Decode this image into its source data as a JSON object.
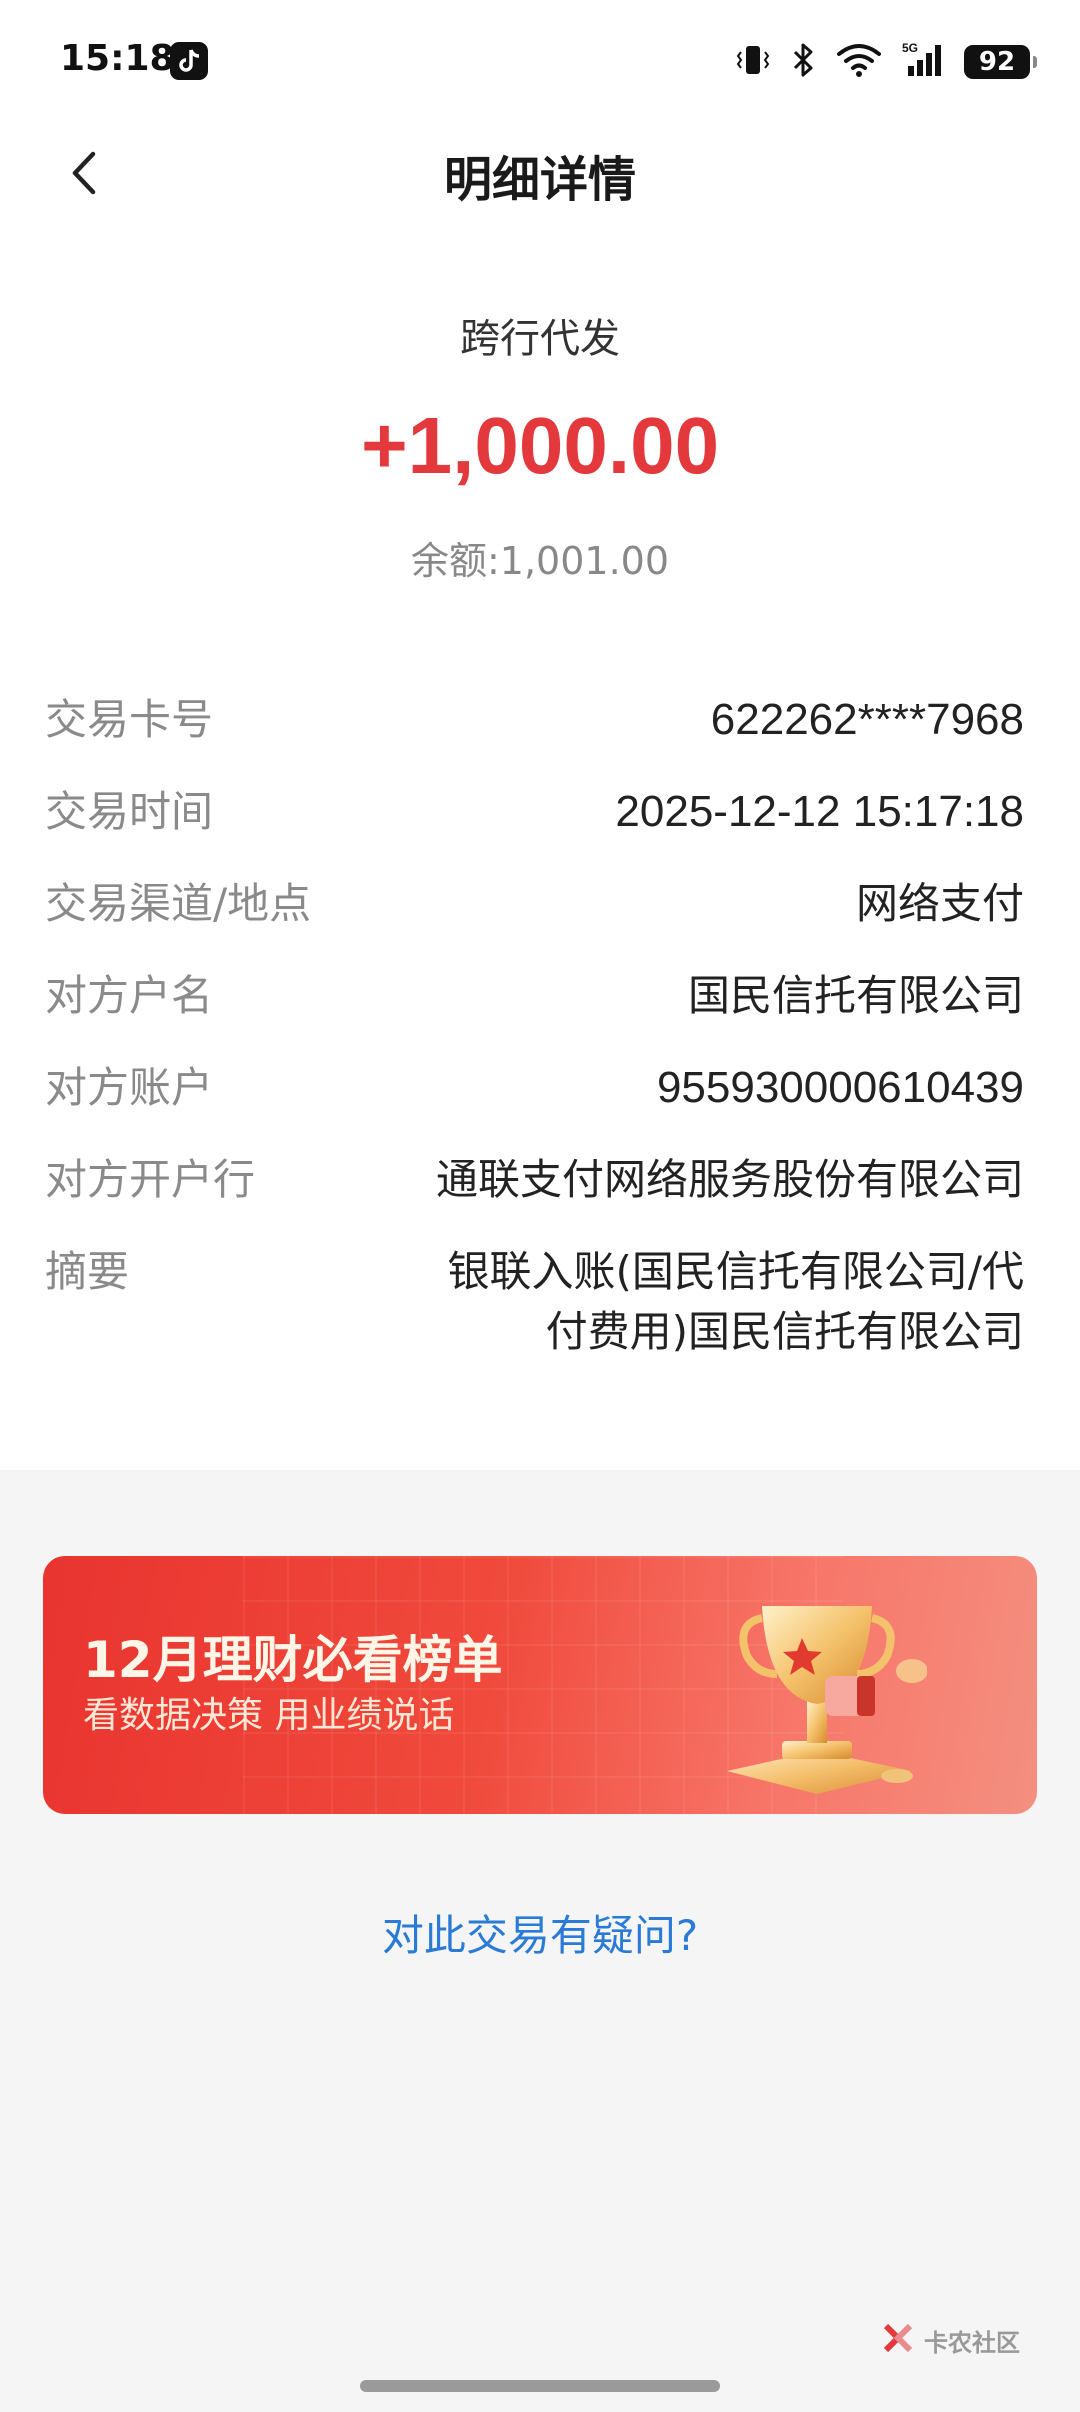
{
  "status_bar": {
    "time": "15:18",
    "battery": "92",
    "icons": [
      "tiktok-icon",
      "vibrate-icon",
      "bluetooth-icon",
      "wifi-icon",
      "5g-signal-icon",
      "battery-icon"
    ]
  },
  "header": {
    "title": "明细详情",
    "back_icon": "chevron-left-icon"
  },
  "transaction": {
    "type": "跨行代发",
    "amount": "+1,000.00",
    "balance": "余额:1,001.00",
    "amount_color": "#e4393c"
  },
  "details": [
    {
      "label": "交易卡号",
      "value": "622262****7968"
    },
    {
      "label": "交易时间",
      "value": "2025-12-12 15:17:18"
    },
    {
      "label": "交易渠道/地点",
      "value": "网络支付"
    },
    {
      "label": "对方户名",
      "value": "国民信托有限公司"
    },
    {
      "label": "对方账户",
      "value": "955930000610439"
    },
    {
      "label": "对方开户行",
      "value": "通联支付网络服务股份有限公司"
    },
    {
      "label": "摘要",
      "value": "银联入账(国民信托有限公司/代付费用)国民信托有限公司"
    }
  ],
  "banner": {
    "title": "12月理财必看榜单",
    "subtitle": "看数据决策 用业绩说话",
    "icon": "trophy-icon"
  },
  "question_link": "对此交易有疑问?",
  "watermark": {
    "text": "卡农社区",
    "icon": "kanong-logo-icon"
  },
  "colors": {
    "accent_red": "#e4393c",
    "link_blue": "#2a7bd6"
  }
}
